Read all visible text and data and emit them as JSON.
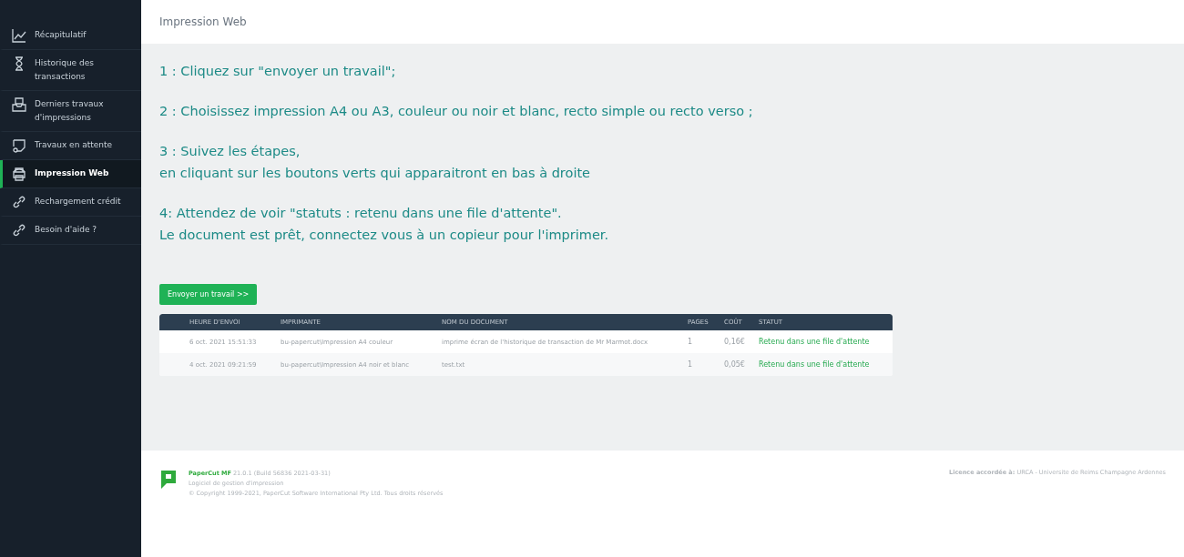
{
  "sidebar": {
    "items": [
      {
        "label": "Récapitulatif",
        "kind": "chart",
        "selected": false
      },
      {
        "label": "Historique des transactions",
        "kind": "hourglass",
        "selected": false
      },
      {
        "label": "Derniers travaux d'impressions",
        "kind": "tray",
        "selected": false
      },
      {
        "label": "Travaux en attente",
        "kind": "pending",
        "selected": false
      },
      {
        "label": "Impression Web",
        "kind": "printer",
        "selected": true
      },
      {
        "label": "Rechargement crédit",
        "kind": "link",
        "selected": false
      },
      {
        "label": "Besoin d'aide ?",
        "kind": "link",
        "selected": false
      }
    ]
  },
  "header": {
    "title": "Impression Web"
  },
  "instructions": [
    [
      "1 : Cliquez sur \"envoyer un travail\";"
    ],
    [
      "2 : Choisissez impression A4 ou A3, couleur ou noir et blanc, recto simple ou recto verso ;"
    ],
    [
      "3 : Suivez les étapes,",
      "en cliquant sur les boutons verts qui apparaitront en bas à droite"
    ],
    [
      "4: Attendez de voir \"statuts : retenu dans une file d'attente\".",
      "Le document est prêt, connectez vous à un copieur pour l'imprimer."
    ]
  ],
  "send_button": "Envoyer un travail >>",
  "table": {
    "columns": [
      "HEURE D'ENVOI",
      "IMPRIMANTE",
      "NOM DU DOCUMENT",
      "PAGES",
      "COÛT",
      "STATUT"
    ],
    "rows": [
      [
        "6 oct. 2021 15:51:33",
        "bu-papercut\\Impression A4 couleur",
        "imprime écran de l'historique de transaction de Mr Marmot.docx",
        "1",
        "0,16€",
        "Retenu dans une file d'attente"
      ],
      [
        "4 oct. 2021 09:21:59",
        "bu-papercut\\Impression A4 noir et blanc",
        "test.txt",
        "1",
        "0,05€",
        "Retenu dans une file d'attente"
      ]
    ]
  },
  "footer": {
    "product": "PaperCut MF",
    "version": "21.0.1 (Build 56836 2021-03-31)",
    "tagline": "Logiciel de gestion d'impression",
    "copyright": "© Copyright 1999-2021, PaperCut Software International Pty Ltd. Tous droits réservés",
    "license_label": "Licence accordée à:",
    "license": "URCA - Universite de Reims Champagne Ardennes"
  }
}
